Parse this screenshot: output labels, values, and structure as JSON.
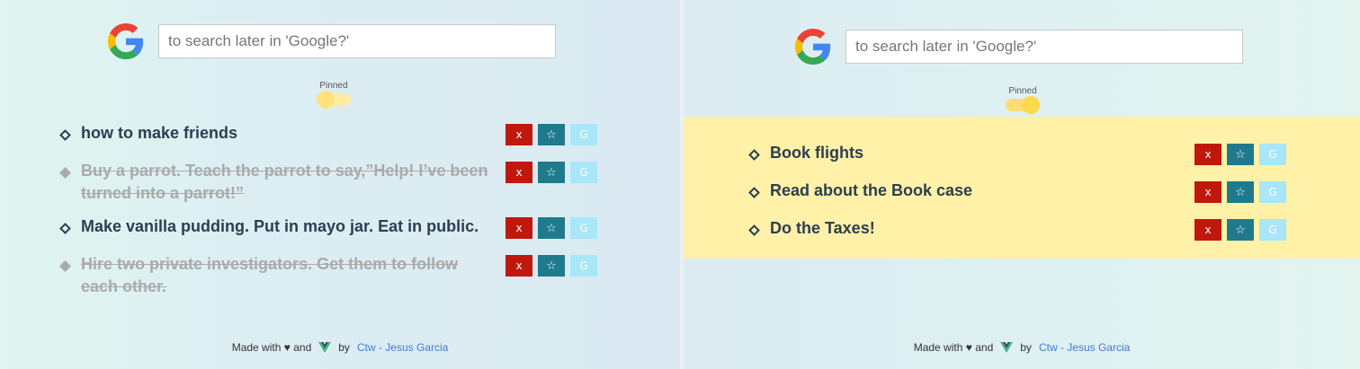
{
  "search": {
    "placeholder": "to search later in 'Google?'"
  },
  "pinned_label": "Pinned",
  "left": {
    "toggle_state": "off",
    "todos": [
      {
        "text": "how to make friends",
        "done": false
      },
      {
        "text": "Buy a parrot. Teach the parrot to say,”Help! I’ve been turned into a parrot!”",
        "done": true
      },
      {
        "text": "Make vanilla pudding. Put in mayo jar. Eat in public.",
        "done": false
      },
      {
        "text": "Hire two private investigators. Get them to follow each other.",
        "done": true
      }
    ]
  },
  "right": {
    "toggle_state": "on",
    "todos": [
      {
        "text": "Book flights",
        "done": false
      },
      {
        "text": "Read about the Book case",
        "done": false
      },
      {
        "text": "Do the Taxes!",
        "done": false
      }
    ]
  },
  "buttons": {
    "delete": "x",
    "pin": "☆",
    "google": "G"
  },
  "footer": {
    "made_with": "Made with",
    "heart": "♥",
    "and": "and",
    "by": "by",
    "author": "Ctw - Jesus Garcia"
  },
  "colors": {
    "delete": "#c0180c",
    "pin": "#1f7a8c",
    "google": "#a8e6f8",
    "pinned_band": "#fff1a8"
  }
}
